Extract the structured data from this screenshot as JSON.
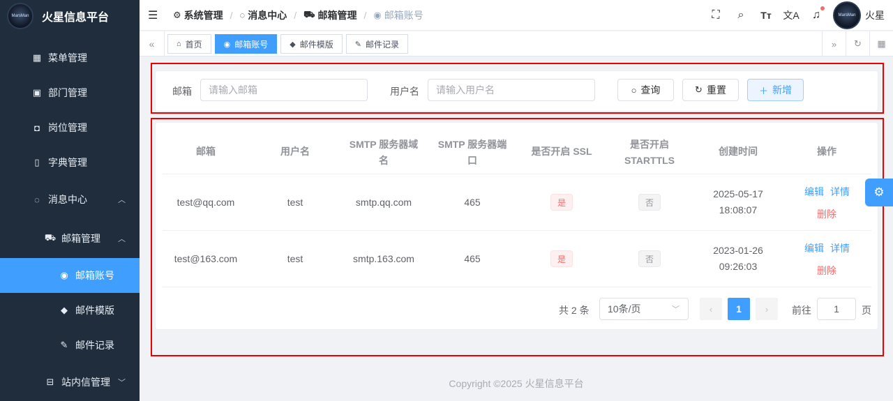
{
  "app": {
    "title": "火星信息平台",
    "logo_text": "MarsMan"
  },
  "sidebar": {
    "items": [
      {
        "label": "菜单管理",
        "icon": "grid-icon"
      },
      {
        "label": "部门管理",
        "icon": "id-card-icon"
      },
      {
        "label": "岗位管理",
        "icon": "user-badge-icon"
      },
      {
        "label": "字典管理",
        "icon": "book-icon"
      },
      {
        "label": "消息中心",
        "icon": "chat-icon"
      },
      {
        "label": "邮箱管理",
        "icon": "mail-truck-icon"
      },
      {
        "label": "邮箱账号",
        "icon": "account-icon"
      },
      {
        "label": "邮件模版",
        "icon": "tag-icon"
      },
      {
        "label": "邮件记录",
        "icon": "edit-icon"
      },
      {
        "label": "站内信管理",
        "icon": "inbox-icon"
      }
    ]
  },
  "header": {
    "breadcrumbs": [
      "系统管理",
      "消息中心",
      "邮箱管理",
      "邮箱账号"
    ],
    "username": "火星"
  },
  "tags": [
    "首页",
    "邮箱账号",
    "邮件模版",
    "邮件记录"
  ],
  "search": {
    "email_label": "邮箱",
    "email_placeholder": "请输入邮箱",
    "username_label": "用户名",
    "username_placeholder": "请输入用户名",
    "query_button": "查询",
    "reset_button": "重置",
    "add_button": "新增"
  },
  "table": {
    "headers": [
      "邮箱",
      "用户名",
      "SMTP 服务器域名",
      "SMTP 服务器端口",
      "是否开启 SSL",
      "是否开启 STARTTLS",
      "创建时间",
      "操作"
    ],
    "rows": [
      {
        "email": "test@qq.com",
        "username": "test",
        "host": "smtp.qq.com",
        "port": "465",
        "ssl": "是",
        "starttls": "否",
        "date": "2025-05-17",
        "time": "18:08:07"
      },
      {
        "email": "test@163.com",
        "username": "test",
        "host": "smtp.163.com",
        "port": "465",
        "ssl": "是",
        "starttls": "否",
        "date": "2023-01-26",
        "time": "09:26:03"
      }
    ],
    "actions": {
      "edit": "编辑",
      "detail": "详情",
      "delete": "删除"
    }
  },
  "pagination": {
    "total": "共 2 条",
    "page_size": "10条/页",
    "current_page": "1",
    "goto_label": "前往",
    "goto_value": "1",
    "page_suffix": "页"
  },
  "footer": {
    "copyright": "Copyright ©2025 火星信息平台"
  }
}
